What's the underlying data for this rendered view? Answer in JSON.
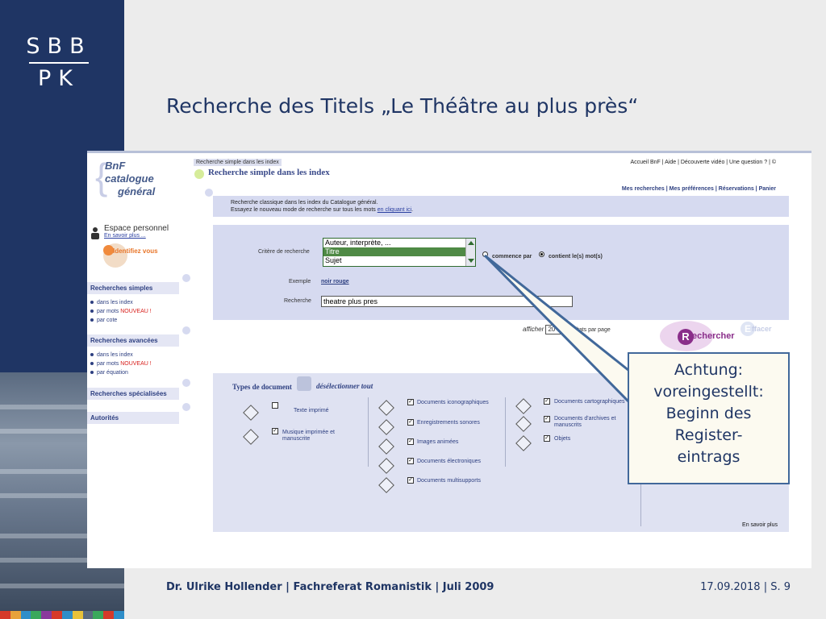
{
  "slide": {
    "logo_line1": "SBB",
    "logo_line2": "PK",
    "title": "Recherche des Titels „Le Théâtre au plus près“",
    "footer_left": "Dr. Ulrike Hollender | Fachreferat Romanistik | Juli 2009",
    "footer_right": "17.09.2018 | S. 9",
    "color_strip": [
      "#d63a2a",
      "#e8a23a",
      "#2f8ec9",
      "#3aa85c",
      "#8a3a9c",
      "#d63a2a",
      "#2f8ec9",
      "#e8c23a",
      "#5a6a80",
      "#3aa85c",
      "#d63a2a",
      "#2f8ec9"
    ]
  },
  "bnf": {
    "logo_lines": [
      "BnF",
      "catalogue",
      "général"
    ],
    "breadcrumb": "Recherche simple dans les index",
    "page_heading": "Recherche simple dans les index",
    "top_nav": "Accueil BnF | Aide | Découverte vidéo | Une question ? | ©",
    "sub_nav": "Mes recherches | Mes préférences | Réservations | Panier",
    "espace": {
      "label": "Espace personnel",
      "more": "En savoir plus ...",
      "identify": "Identifiez vous"
    },
    "sidebar": {
      "simple_head": "Recherches simples",
      "simple_items": [
        "dans les index",
        "par mots",
        "par cote"
      ],
      "new_badge": "NOUVEAU !",
      "advanced_head": "Recherches avancées",
      "advanced_items": [
        "dans les index",
        "par mots",
        "par équation"
      ],
      "special_head": "Recherches spécialisées",
      "authorities_head": "Autorités"
    },
    "intro": {
      "line1": "Recherche classique dans les index du Catalogue général.",
      "line2_prefix": "Essayez le nouveau mode de recherche sur tous les mots",
      "line2_link": "en cliquant ici",
      "line2_suffix": "."
    },
    "form": {
      "criteria_label": "Critère de recherche",
      "options": [
        "Auteur, interprète, ...",
        "Titre",
        "Sujet"
      ],
      "selected_option": "Titre",
      "radio_begins": "commence par",
      "radio_contains": "contient le(s) mot(s)",
      "example_label": "Exemple",
      "example_value": "noir rouge",
      "search_label": "Recherche",
      "search_value": "theatre plus pres"
    },
    "results": {
      "show_label": "afficher",
      "show_value": "20",
      "per_page": "résultats par page"
    },
    "buttons": {
      "search_initial": "R",
      "search_rest": "echercher",
      "clear_initial": "E",
      "clear_rest": "ffacer"
    },
    "types": {
      "heading": "Types de document",
      "deselect": "désélectionner tout",
      "col1": [
        {
          "label": "Texte imprimé",
          "checked": false
        },
        {
          "label": "Musique imprimée et manuscrite",
          "checked": true
        }
      ],
      "col2": [
        {
          "label": "Documents iconographiques",
          "checked": true
        },
        {
          "label": "Enregistrements sonores",
          "checked": true
        },
        {
          "label": "Images animées",
          "checked": true
        },
        {
          "label": "Documents électroniques",
          "checked": true
        },
        {
          "label": "Documents multisupports",
          "checked": true
        }
      ],
      "col3": [
        {
          "label": "Documents cartographiques",
          "checked": true
        },
        {
          "label": "Documents d'archives et manuscrits",
          "checked": true
        },
        {
          "label": "Objets",
          "checked": true
        }
      ],
      "more": "En savoir plus"
    }
  },
  "callout": {
    "lines": [
      "Achtung:",
      "voreingestellt:",
      "Beginn des",
      "Register-",
      "eintrags"
    ]
  }
}
